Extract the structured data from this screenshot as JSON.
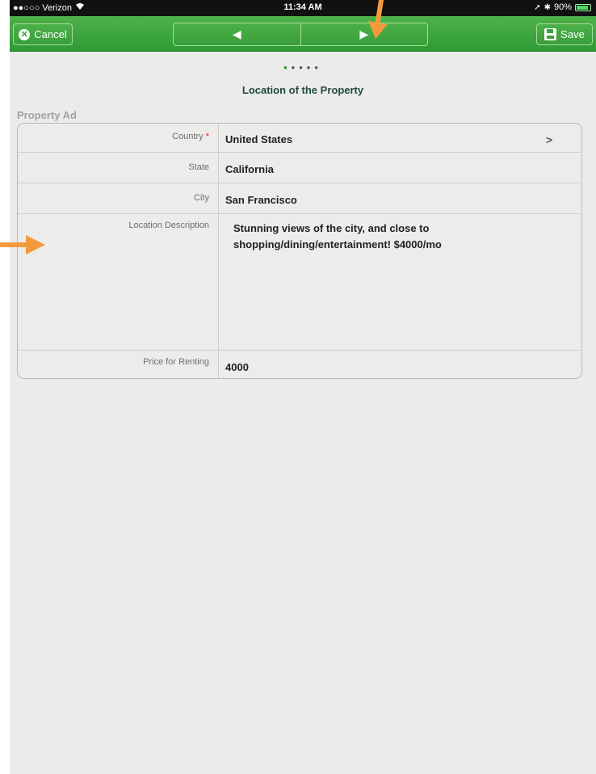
{
  "statusbar": {
    "carrier": "●●○○○ Verizon",
    "wifi_icon": "wifi-icon",
    "time": "11:34 AM",
    "battery_pct": "90%",
    "battery_level": 0.9
  },
  "toolbar": {
    "cancel_label": "Cancel",
    "save_label": "Save",
    "prev_glyph": "◀",
    "next_glyph": "▶"
  },
  "page": {
    "dots": 5,
    "active_dot": 0,
    "title": "Location of the Property",
    "section": "Property Ad"
  },
  "form": {
    "rows": [
      {
        "label": "Country",
        "required": true,
        "value": "United States",
        "has_chevron": true
      },
      {
        "label": "State",
        "value": "California"
      },
      {
        "label": "City",
        "value": "San Francisco"
      },
      {
        "label": "Location Description",
        "value": "Stunning views of the city, and close to shopping/dining/entertainment! $4000/mo"
      },
      {
        "label": "Price for Renting",
        "value": "4000"
      }
    ]
  },
  "colors": {
    "toolbar_green": "#3aa23a",
    "title_green": "#1f4b3a",
    "annotation_orange": "#f39a3d",
    "required_red": "#e02424"
  }
}
